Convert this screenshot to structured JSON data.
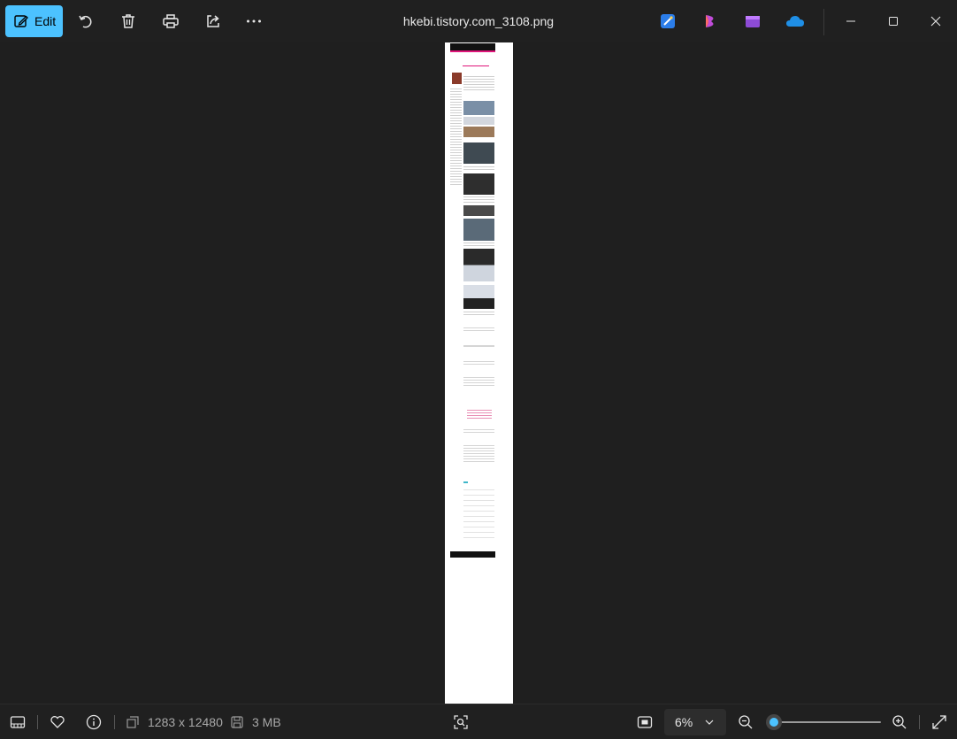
{
  "toolbar": {
    "edit_label": "Edit",
    "title": "hkebi.tistory.com_3108.png",
    "icons": [
      "edit-icon",
      "rotate-icon",
      "delete-icon",
      "print-icon",
      "share-icon",
      "more-icon"
    ],
    "app_icons": [
      "designer-icon",
      "clipchamp-icon",
      "video-editor-icon",
      "onedrive-icon"
    ],
    "colors": {
      "accent": "#4cc2ff",
      "background": "#202020"
    }
  },
  "statusbar": {
    "dimensions": "1283 x 12480",
    "file_size": "3 MB",
    "zoom": "6%",
    "zoom_level": 0.06
  }
}
